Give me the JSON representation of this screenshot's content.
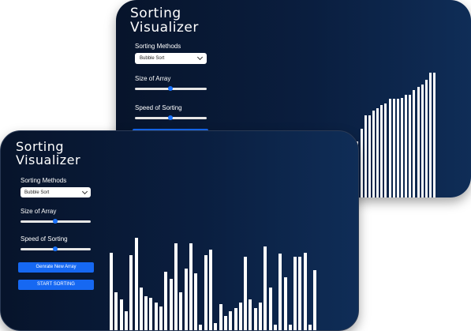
{
  "app": {
    "title_line1": "Sorting",
    "title_line2": "Visualizer",
    "methods_label": "Sorting Methods",
    "method_selected": "Bubble Sort",
    "size_label": "Size of Array",
    "speed_label": "Speed of Sorting",
    "generate_button": "Genrate New Array",
    "start_button": "START SORTING",
    "size_slider_value": 0.5,
    "speed_slider_value": 0.5
  },
  "back_bars": [
    8,
    9,
    10,
    12,
    14,
    18,
    22,
    27,
    30,
    38,
    47,
    56,
    56,
    59,
    61,
    63,
    64,
    67,
    67,
    67,
    68,
    70,
    70,
    73,
    75,
    77,
    80,
    85,
    85
  ],
  "front_bars": [
    54,
    27,
    22,
    14,
    52,
    64,
    30,
    24,
    23,
    20,
    17,
    41,
    36,
    60,
    27,
    43,
    60,
    40,
    5,
    52,
    56,
    6,
    19,
    11,
    14,
    16,
    20,
    51,
    22,
    16,
    20,
    58,
    30,
    5,
    53,
    37,
    5,
    51,
    51,
    54,
    5,
    42
  ],
  "colors": {
    "bg_dark": "#07142b",
    "bg_light": "#0f2d57",
    "accent": "#1668f2",
    "bar": "#ffffff"
  }
}
